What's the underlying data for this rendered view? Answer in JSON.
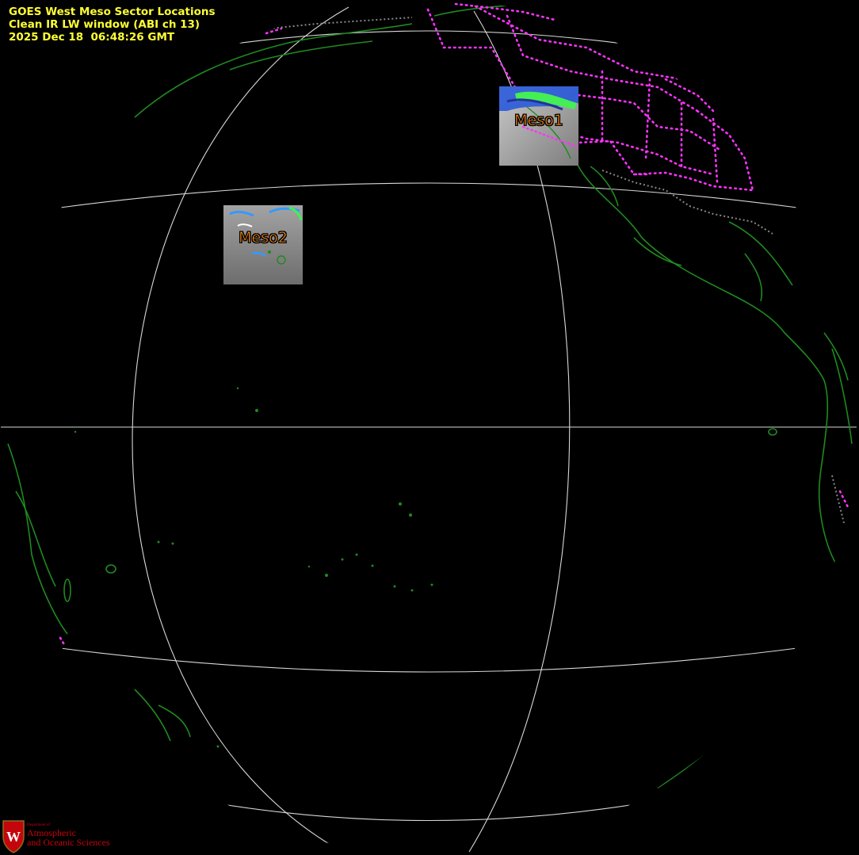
{
  "title": {
    "line1": "GOES West Meso Sector Locations",
    "line2": "Clean IR LW window (ABI ch 13)",
    "line3": "2025 Dec 18  06:48:26 GMT"
  },
  "sectors": [
    {
      "label": "Meso1"
    },
    {
      "label": "Meso2"
    }
  ],
  "logo": {
    "dept_small": "Department of",
    "line1": "Atmospheric",
    "line2": "and Oceanic Sciences"
  },
  "colors": {
    "background": "#000000",
    "title": "#ffff33",
    "gridlines": "#d8d8d8",
    "coastlines": "#1f8a1f",
    "borders": "#ff33ff",
    "sector_label": "#ff8c1a",
    "logo": "#c5050c"
  }
}
